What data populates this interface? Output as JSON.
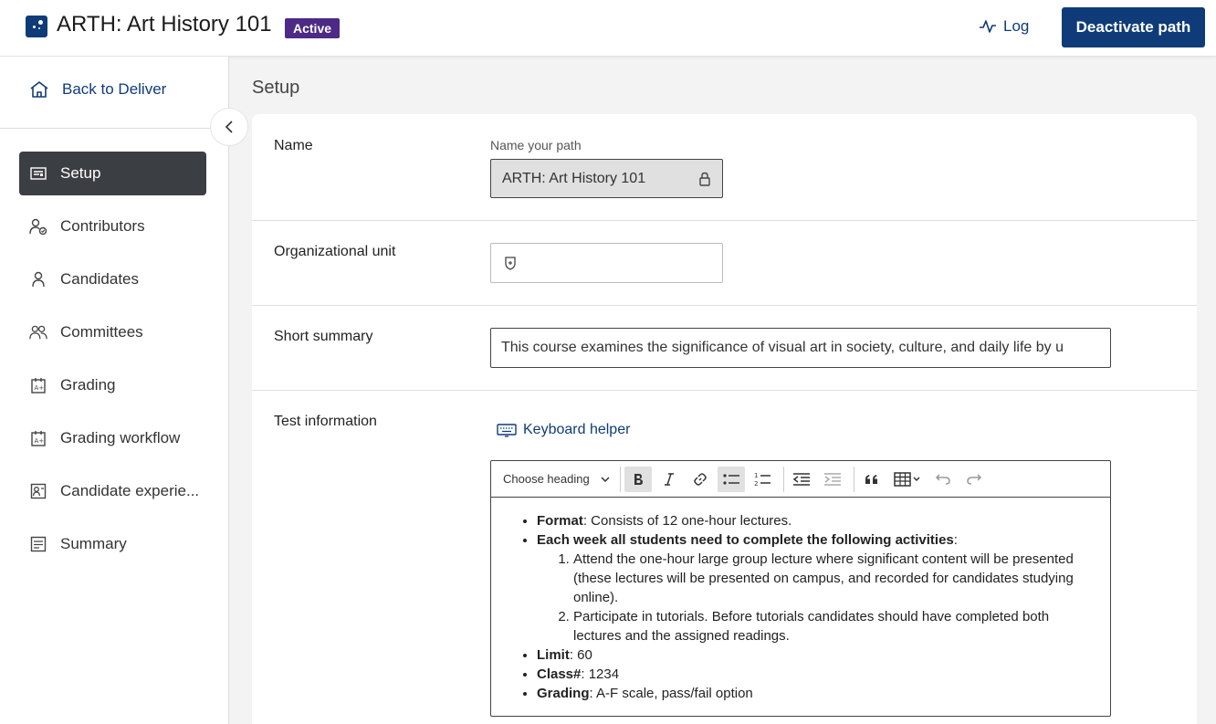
{
  "header": {
    "title": "ARTH: Art History 101",
    "badge": "Active",
    "log_label": "Log",
    "deactivate_label": "Deactivate path"
  },
  "sidebar": {
    "back_label": "Back to Deliver",
    "items": [
      {
        "label": "Setup",
        "icon": "setup-icon",
        "active": true
      },
      {
        "label": "Contributors",
        "icon": "contributors-icon"
      },
      {
        "label": "Candidates",
        "icon": "person-icon"
      },
      {
        "label": "Committees",
        "icon": "group-icon"
      },
      {
        "label": "Grading",
        "icon": "grading-icon"
      },
      {
        "label": "Grading workflow",
        "icon": "grading-workflow-icon"
      },
      {
        "label": "Candidate experie...",
        "icon": "candidate-experience-icon"
      },
      {
        "label": "Summary",
        "icon": "summary-icon"
      }
    ]
  },
  "main": {
    "title": "Setup",
    "name": {
      "label": "Name",
      "hint": "Name your path",
      "value": "ARTH: Art History 101"
    },
    "org_unit": {
      "label": "Organizational unit",
      "value": ""
    },
    "short_summary": {
      "label": "Short summary",
      "value": "This course examines the significance of visual art in society, culture, and daily life by u"
    },
    "test_info": {
      "label": "Test information",
      "keyboard_helper": "Keyboard helper",
      "heading_select": "Choose heading",
      "content": {
        "format_label": "Format",
        "format_text": ": Consists of 12 one-hour lectures.",
        "weekly_label": "Each week all students need to complete the following activities",
        "weekly_suffix": ":",
        "activities": [
          "Attend the one-hour large group lecture where significant content will be presented (these lectures will be presented on campus, and recorded for candidates studying online).",
          "Participate in tutorials. Before tutorials candidates should have completed both lectures and the assigned readings."
        ],
        "limit_label": "Limit",
        "limit_text": ": 60",
        "class_label": "Class#",
        "class_text": ": 1234",
        "grading_label": "Grading",
        "grading_text": ": A-F scale, pass/fail option"
      }
    }
  },
  "colors": {
    "brand": "#0f3c78",
    "badge": "#4c2a85",
    "nav_active": "#3b3f44"
  }
}
